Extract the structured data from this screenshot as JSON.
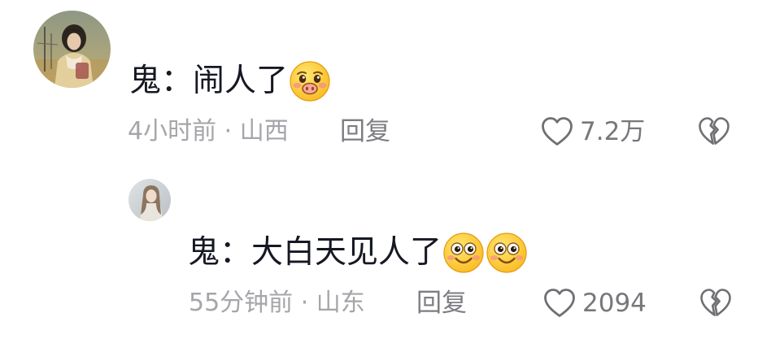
{
  "colors": {
    "background": "#ffffff",
    "text": "#161823",
    "meta": "#a5a5aa",
    "action": "#7d7d82",
    "icon_stroke": "#6f6f74",
    "emoji_yellow": "#ffd23c"
  },
  "icons": {
    "like": "heart-outline-icon",
    "dislike": "broken-heart-icon"
  },
  "comment": {
    "avatar": "user-avatar-photo",
    "text": "鬼：闹人了",
    "emojis": [
      "shy-face-emoji"
    ],
    "meta": "4小时前 · 山西",
    "reply_label": "回复",
    "like_count": "7.2万"
  },
  "reply": {
    "avatar": "user-avatar-photo",
    "text": "鬼：大白天见人了",
    "emojis": [
      "smiling-face-emoji",
      "smiling-face-emoji"
    ],
    "meta": "55分钟前 · 山东",
    "reply_label": "回复",
    "like_count": "2094"
  }
}
